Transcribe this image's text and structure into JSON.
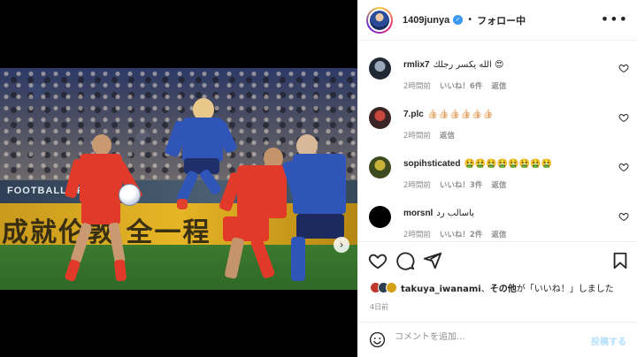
{
  "post": {
    "photo_banner_text": "成就伦敦  全一程",
    "photo_board_text": "FOOTBALL  JFA  FIFA"
  },
  "carousel": {
    "slides": 2,
    "active": 1
  },
  "header": {
    "username": "1409junya",
    "separator": "•",
    "follow_status": "フォロー中",
    "more": "•••"
  },
  "comments": [
    {
      "username": "rmlix7",
      "text": "الله يكسر رجلك 😍",
      "time": "2時間前",
      "likes": "いいね！6件",
      "reply": "返信"
    },
    {
      "username": "7.plc",
      "text": "👍🏻👍🏻👍🏻👍🏻👍🏻👍🏻",
      "time": "2時間前",
      "likes": "",
      "reply": "返信"
    },
    {
      "username": "sopihsticated",
      "text": "🤮🤮🤮🤮🤮🤮🤮🤮",
      "time": "2時間前",
      "likes": "いいね！3件",
      "reply": "返信"
    },
    {
      "username": "morsnl",
      "text": "ياسالب رد",
      "time": "2時間前",
      "likes": "いいね！2件",
      "reply": "返信"
    }
  ],
  "likes_summary": {
    "first_liker": "takuya_iwanami",
    "joiner": "、",
    "others": "その他",
    "suffix": "が「いいね！」しました"
  },
  "post_time": "4日前",
  "comment_box": {
    "placeholder": "コメントを追加...",
    "post_label": "投稿する"
  },
  "icons": {
    "emoji": "smiley-icon",
    "heart": "heart-icon",
    "comment": "comment-icon",
    "share": "share-icon",
    "save": "bookmark-icon"
  },
  "colors": {
    "accent": "#3897f0",
    "post_disabled": "#b2dffc",
    "muted": "#8e8e8e",
    "japan_kit": "#2f55b8",
    "china_kit": "#e23a2a"
  }
}
